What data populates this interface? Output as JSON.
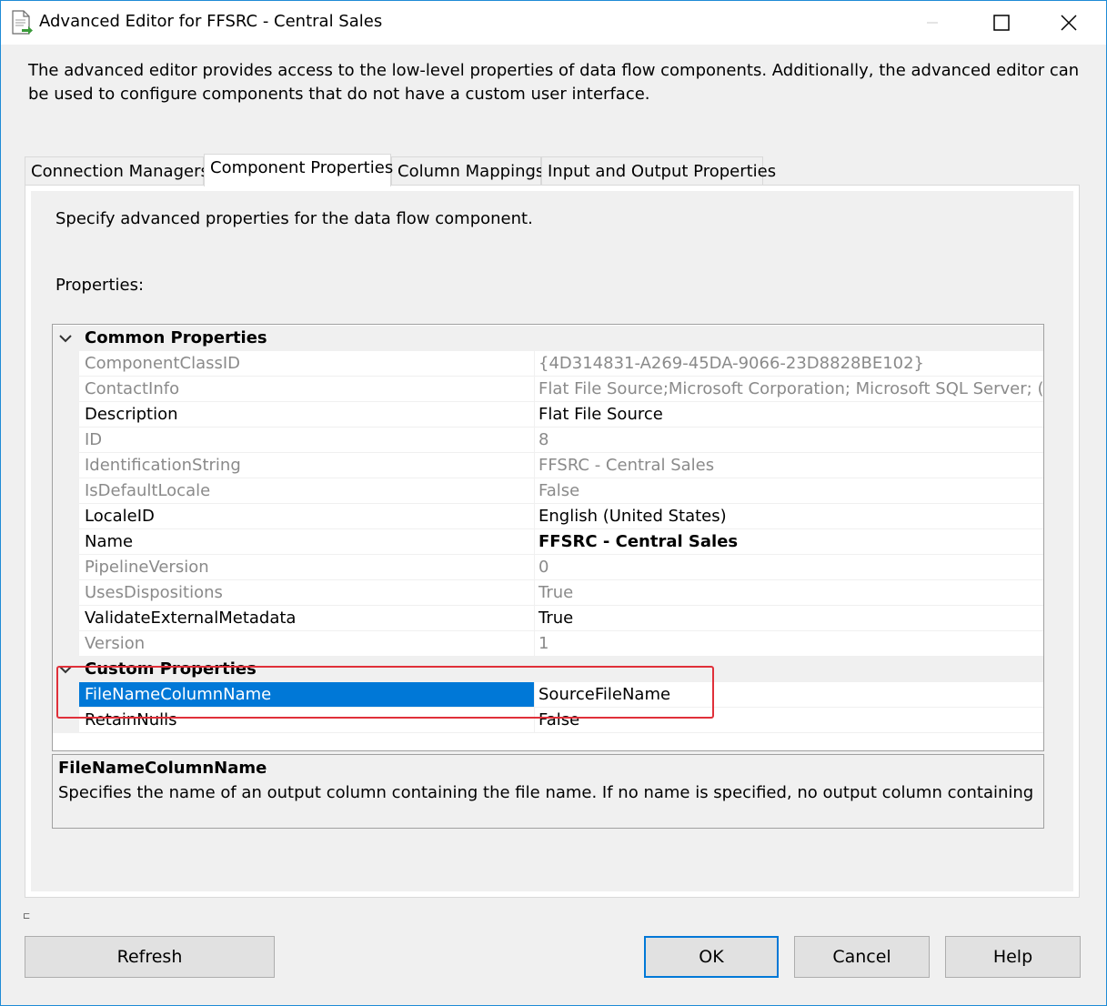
{
  "window": {
    "title": "Advanced Editor for FFSRC - Central Sales",
    "app_icon": "document-arrow-icon",
    "controls": [
      "minimize-icon",
      "maximize-icon",
      "close-icon"
    ]
  },
  "intro_text": "The advanced editor provides access to the low-level properties of data flow components. Additionally, the advanced editor can be used to configure components that do not have a custom user interface.",
  "tabs": [
    {
      "label": "Connection Managers"
    },
    {
      "label": "Component Properties"
    },
    {
      "label": "Column Mappings"
    },
    {
      "label": "Input and Output Properties"
    }
  ],
  "active_tab": "Component Properties",
  "panel": {
    "description": "Specify advanced properties for the data flow component.",
    "properties_label": "Properties:"
  },
  "grid": {
    "common": {
      "label": "Common Properties",
      "rows": [
        {
          "name": "ComponentClassID",
          "value": "{4D314831-A269-45DA-9066-23D8828BE102}",
          "readonly": true
        },
        {
          "name": "ContactInfo",
          "value": "Flat File Source;Microsoft Corporation; Microsoft SQL Server; (C) M",
          "readonly": true
        },
        {
          "name": "Description",
          "value": "Flat File Source",
          "readonly": false
        },
        {
          "name": "ID",
          "value": "8",
          "readonly": true
        },
        {
          "name": "IdentificationString",
          "value": "FFSRC - Central Sales",
          "readonly": true
        },
        {
          "name": "IsDefaultLocale",
          "value": "False",
          "readonly": true
        },
        {
          "name": "LocaleID",
          "value": "English (United States)",
          "readonly": false
        },
        {
          "name": "Name",
          "value": "FFSRC - Central Sales",
          "readonly": false
        },
        {
          "name": "PipelineVersion",
          "value": "0",
          "readonly": true
        },
        {
          "name": "UsesDispositions",
          "value": "True",
          "readonly": true
        },
        {
          "name": "ValidateExternalMetadata",
          "value": "True",
          "readonly": false
        },
        {
          "name": "Version",
          "value": "1",
          "readonly": true
        }
      ]
    },
    "custom": {
      "label": "Custom Properties",
      "rows": [
        {
          "name": "FileNameColumnName",
          "value": "SourceFileName",
          "readonly": false,
          "selected": true
        },
        {
          "name": "RetainNulls",
          "value": "False",
          "readonly": false
        }
      ]
    },
    "highlight_color": "#e0303a",
    "selection_color": "#0078d7"
  },
  "help": {
    "title": "FileNameColumnName",
    "text": "Specifies the name of an output column containing the file name. If no name is specified, no output column containing the f..."
  },
  "buttons": {
    "refresh": "Refresh",
    "ok": "OK",
    "cancel": "Cancel",
    "help": "Help"
  }
}
